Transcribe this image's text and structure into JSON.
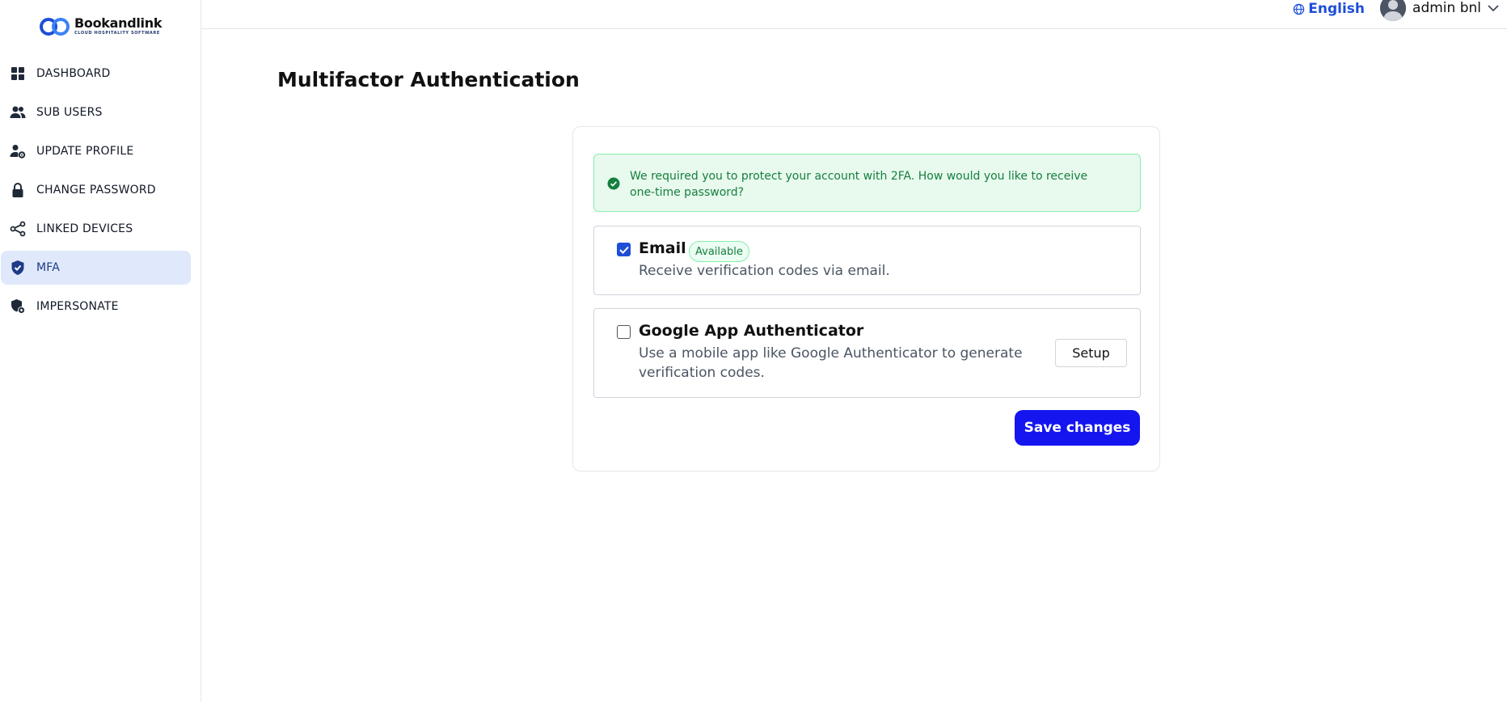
{
  "brand": {
    "name": "Bookandlink",
    "tagline": "CLOUD HOSPITALITY SOFTWARE"
  },
  "sidebar": {
    "items": [
      {
        "label": "DASHBOARD",
        "icon": "dashboard-icon"
      },
      {
        "label": "SUB USERS",
        "icon": "users-icon"
      },
      {
        "label": "UPDATE PROFILE",
        "icon": "user-gear-icon"
      },
      {
        "label": "CHANGE PASSWORD",
        "icon": "lock-icon"
      },
      {
        "label": "LINKED DEVICES",
        "icon": "share-icon"
      },
      {
        "label": "MFA",
        "icon": "shield-icon",
        "active": true
      },
      {
        "label": "IMPERSONATE",
        "icon": "impersonate-icon"
      }
    ]
  },
  "header": {
    "language": "English",
    "user_name": "admin bnl"
  },
  "main": {
    "title": "Multifactor Authentication",
    "alert": {
      "text": "We required you to protect your account with 2FA. How would you like to receive one-time password?"
    },
    "options": [
      {
        "title": "Email",
        "badge": "Available",
        "description": "Receive verification codes via email.",
        "checked": true
      },
      {
        "title": "Google App Authenticator",
        "description_line1": "Use a mobile app like Google Authenticator to generate",
        "description_line2": "verification codes.",
        "checked": false,
        "button": "Setup"
      }
    ],
    "save_label": "Save changes"
  },
  "colors": {
    "accent": "#1515f0",
    "alert_bg": "#e8f9ee",
    "alert_text": "#15803d",
    "active_nav_bg": "#e0e9fb"
  }
}
